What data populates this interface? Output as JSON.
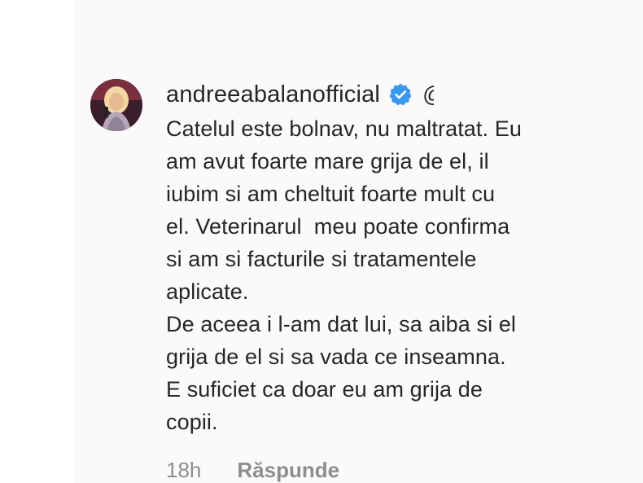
{
  "comment": {
    "username": "andreeabalanofficial",
    "handle_fragment": "@",
    "verified": true,
    "text": "Catelul este bolnav, nu maltratat. Eu\nam avut foarte mare grija de el, il\niubim si am cheltuit foarte mult cu\nel. Veterinarul  meu poate confirma\nsi am si facturile si tratamentele\naplicate.\nDe aceea i l-am dat lui, sa aiba si el\ngrija de el si sa vada ce inseamna.\nE suficiet ca doar eu am grija de\ncopii.",
    "timestamp": "18h",
    "reply_label": "Răspunde"
  },
  "icons": {
    "verified": "verified-badge-icon",
    "avatar": "profile-avatar"
  },
  "colors": {
    "verified_blue": "#3897f0",
    "text": "#262626",
    "muted": "#8e8e8e"
  }
}
